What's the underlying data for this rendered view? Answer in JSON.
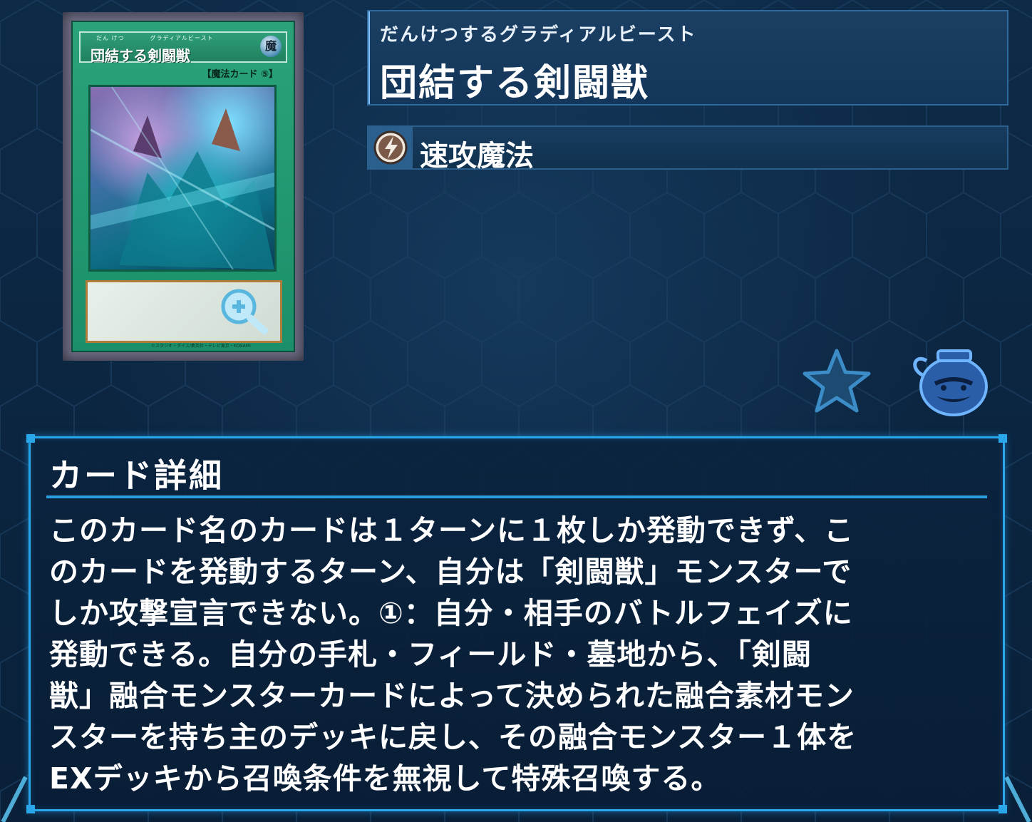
{
  "card_image": {
    "ruby": "だん けつ　　　　グラディアルビースト",
    "name": "団結する剣闘獣",
    "attribute": "魔",
    "type_line": "【魔法カード ⑤】",
    "copyright": "©スタジオ・ダイス/集英社・テレビ東京・KONAMI",
    "zoom_icon": "zoom-in-icon"
  },
  "header": {
    "reading": "だんけつするグラディアルビースト",
    "title": "団結する剣闘獣"
  },
  "spell_type": {
    "label": "速攻魔法",
    "icon": "quick-play-icon"
  },
  "actions": {
    "favorite_icon": "star-icon",
    "pot_icon": "pot-of-greed-icon"
  },
  "detail": {
    "heading": "カード詳細",
    "lines": [
      "このカード名のカードは１ターンに１枚しか発動できず、こ",
      "のカードを発動するターン、自分は「剣闘獣」モンスターで",
      "しか攻撃宣言できない。①：自分・相手のバトルフェイズに",
      "発動できる。自分の手札・フィールド・墓地から、「剣闘",
      "獣」融合モンスターカードによって決められた融合素材モン",
      "スターを持ち主のデッキに戻し、その融合モンスター１体を",
      "EXデッキから召喚条件を無視して特殊召喚する。"
    ]
  },
  "colors": {
    "background": "#0b2540",
    "panel_border": "#2aa6ea",
    "card_green": "#1b8f69"
  }
}
